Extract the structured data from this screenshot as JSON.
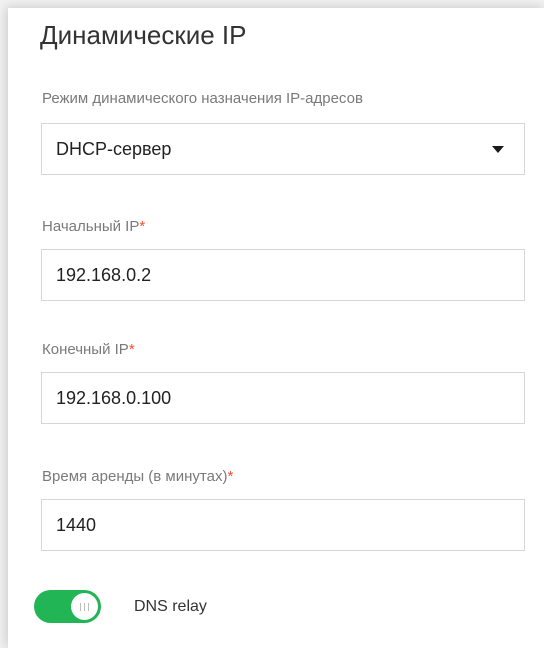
{
  "section": {
    "title": "Динамические IP"
  },
  "mode": {
    "label": "Режим динамического назначения IP-адресов",
    "selected": "DHCP-сервер"
  },
  "start_ip": {
    "label": "Начальный IP",
    "required_mark": "*",
    "value": "192.168.0.2"
  },
  "end_ip": {
    "label": "Конечный IP",
    "required_mark": "*",
    "value": "192.168.0.100"
  },
  "lease_time": {
    "label": "Время аренды (в минутах)",
    "required_mark": "*",
    "value": "1440"
  },
  "dns_relay": {
    "label": "DNS relay",
    "enabled": true
  },
  "colors": {
    "accent": "#21b555",
    "required": "#ff4a2b"
  },
  "icons": {
    "dropdown": "caret-down-icon",
    "toggle_grip": "grip-icon"
  }
}
